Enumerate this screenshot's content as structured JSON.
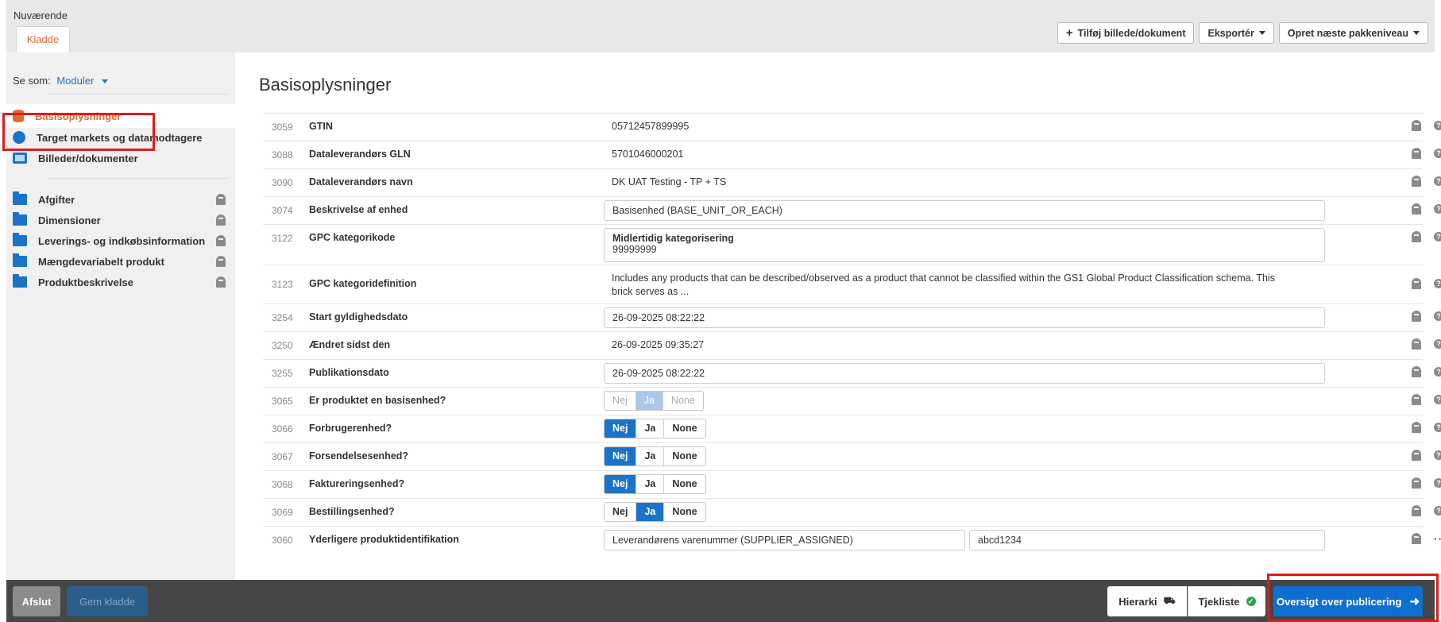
{
  "header": {
    "current_label": "Nuværende",
    "tab_label": "Kladde",
    "buttons": {
      "add_media": "Tilføj billede/dokument",
      "export": "Eksportér",
      "next_level": "Opret næste pakkeniveau"
    }
  },
  "sidebar": {
    "view_as_label": "Se som:",
    "view_as_value": "Moduler",
    "nav": [
      {
        "label": "Basisoplysninger",
        "icon": "database-icon"
      },
      {
        "label": "Target markets og datamodtagere",
        "icon": "globe-icon"
      },
      {
        "label": "Billeder/dokumenter",
        "icon": "image-icon"
      }
    ],
    "modules": [
      {
        "label": "Afgifter"
      },
      {
        "label": "Dimensioner"
      },
      {
        "label": "Leverings- og indkøbsinformation"
      },
      {
        "label": "Mængdevariabelt produkt"
      },
      {
        "label": "Produktbeskrivelse"
      }
    ]
  },
  "main": {
    "title": "Basisoplysninger",
    "rows": [
      {
        "num": "3059",
        "label": "GTIN",
        "value": "05712457899995"
      },
      {
        "num": "3088",
        "label": "Dataleverandørs GLN",
        "value": "5701046000201"
      },
      {
        "num": "3090",
        "label": "Dataleverandørs navn",
        "value": "DK UAT Testing - TP + TS"
      },
      {
        "num": "3074",
        "label": "Beskrivelse af enhed",
        "value": "Basisenhed (BASE_UNIT_OR_EACH)"
      },
      {
        "num": "3122",
        "label": "GPC kategorikode",
        "value_title": "Midlertidig kategorisering",
        "value": "99999999"
      },
      {
        "num": "3123",
        "label": "GPC kategoridefinition",
        "value": "Includes any products that can be described/observed as a product that cannot be classified within the GS1 Global Product Classification schema. This",
        "value2": "brick serves as ..."
      },
      {
        "num": "3254",
        "label": "Start gyldighedsdato",
        "value": "26-09-2025 08:22:22"
      },
      {
        "num": "3250",
        "label": "Ændret sidst den",
        "value": "26-09-2025 09:35:27"
      },
      {
        "num": "3255",
        "label": "Publikationsdato",
        "value": "26-09-2025 08:22:22"
      },
      {
        "num": "3065",
        "label": "Er produktet en basisenhed?"
      },
      {
        "num": "3066",
        "label": "Forbrugerenhed?"
      },
      {
        "num": "3067",
        "label": "Forsendelsesenhed?"
      },
      {
        "num": "3068",
        "label": "Faktureringsenhed?"
      },
      {
        "num": "3069",
        "label": "Bestillingsenhed?"
      },
      {
        "num": "3060",
        "label": "Yderligere produktidentifikation",
        "value": "Leverandørens varenummer (SUPPLIER_ASSIGNED)",
        "value2": "abcd1234"
      }
    ],
    "toggle": {
      "nej": "Nej",
      "ja": "Ja",
      "none": "None"
    }
  },
  "footer": {
    "exit": "Afslut",
    "save_draft": "Gem kladde",
    "hierarchy": "Hierarki",
    "checklist": "Tjekliste",
    "publish_overview": "Oversigt over publicering"
  },
  "colors": {
    "accent": "#e06b2f",
    "primary": "#1a73c8",
    "highlight": "#e01b1b"
  }
}
